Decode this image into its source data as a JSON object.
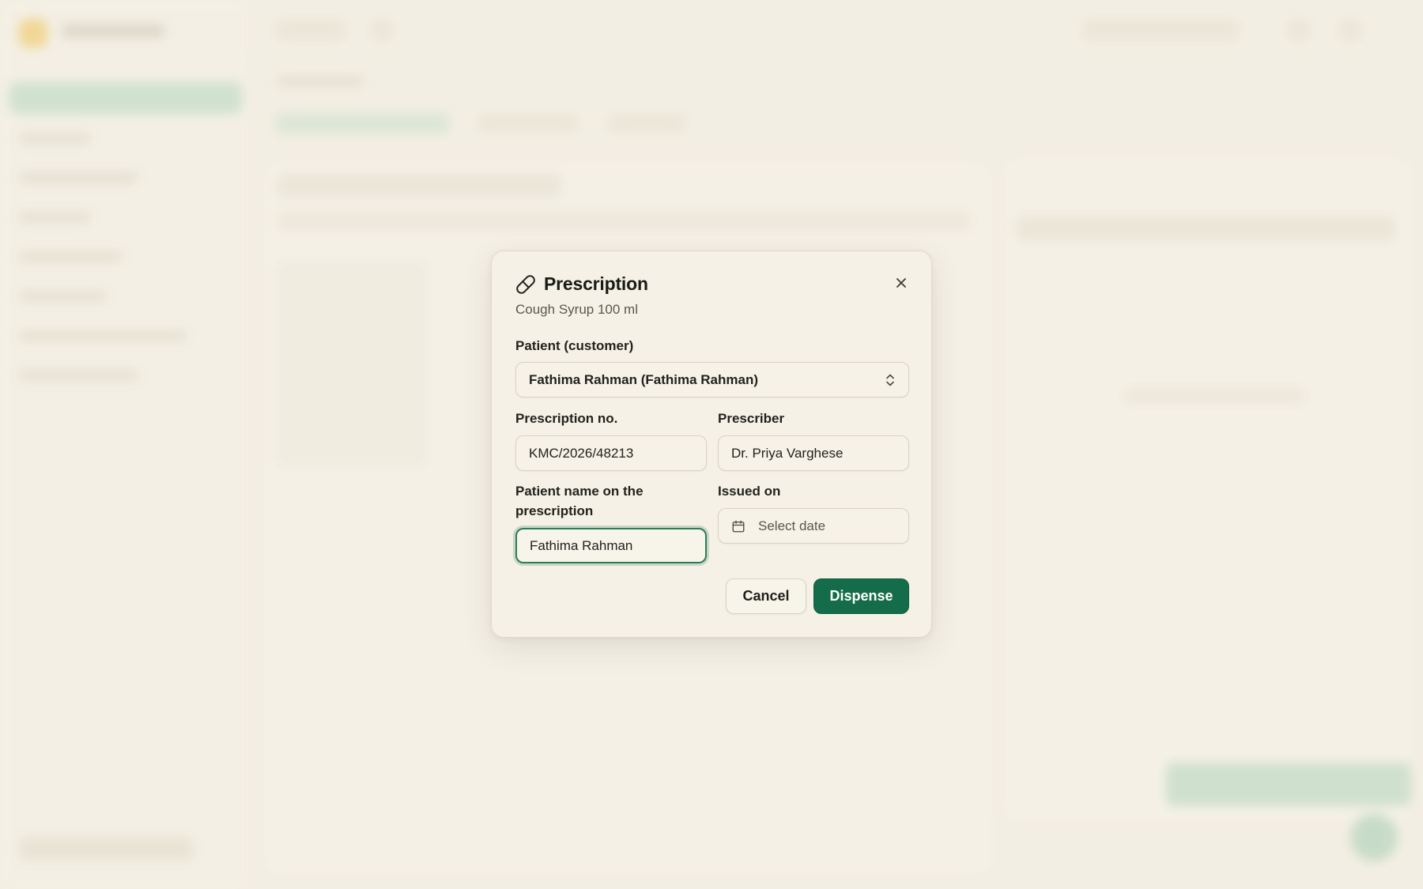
{
  "dialog": {
    "title": "Prescription",
    "subtitle": "Cough Syrup 100 ml",
    "patient": {
      "label": "Patient (customer)",
      "selected": "Fathima Rahman (Fathima Rahman)"
    },
    "prescription_no": {
      "label": "Prescription no.",
      "value": "KMC/2026/48213"
    },
    "prescriber": {
      "label": "Prescriber",
      "value": "Dr. Priya Varghese"
    },
    "patient_name": {
      "label": "Patient name on the prescription",
      "value": "Fathima Rahman"
    },
    "issued_on": {
      "label": "Issued on",
      "placeholder": "Select date"
    },
    "buttons": {
      "cancel": "Cancel",
      "dispense": "Dispense"
    }
  },
  "colors": {
    "accent": "#146c4a",
    "focus_ring": "#2f7a5a",
    "background": "#f3efe3"
  },
  "icons": {
    "title": "pill-icon",
    "close": "close-icon",
    "select": "chevron-up-down-icon",
    "date": "calendar-icon"
  }
}
